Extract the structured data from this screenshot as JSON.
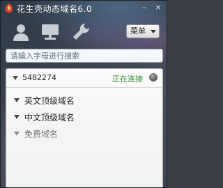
{
  "window": {
    "title": "花生壳动态域名6.0",
    "minimize_label": "–",
    "close_label": "×"
  },
  "toolbar": {
    "icons": [
      "user-icon",
      "monitor-icon",
      "wrench-icon"
    ],
    "menu_label": "菜单"
  },
  "search": {
    "placeholder": "请输入字母进行搜索",
    "value": ""
  },
  "account": {
    "id": "5482274",
    "status": "正在连接"
  },
  "groups": [
    {
      "label": "英文顶级域名"
    },
    {
      "label": "中文顶级域名"
    },
    {
      "label": "免费域名"
    }
  ],
  "colors": {
    "status_green": "#2b8a2b",
    "accent_red": "#d9332b"
  }
}
